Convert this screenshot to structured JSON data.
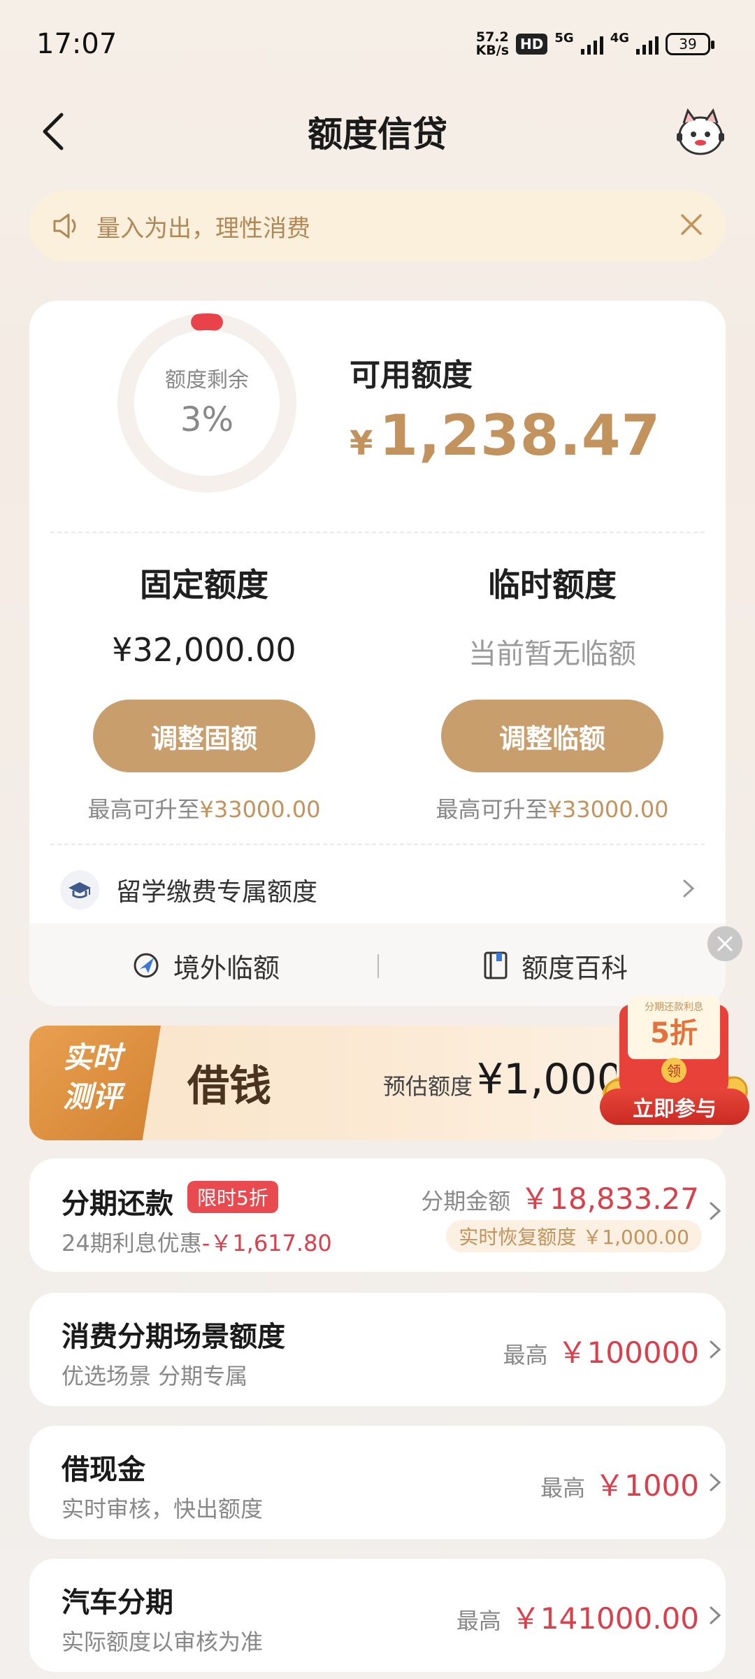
{
  "status": {
    "time": "17:07",
    "speed_top": "57.2",
    "speed_unit": "KB/s",
    "hd": "HD",
    "net1": "5G",
    "net2": "4G",
    "battery": "39"
  },
  "header": {
    "title": "额度信贷"
  },
  "notice": {
    "text": "量入为出，理性消费"
  },
  "credit": {
    "ring_label": "额度剩余",
    "ring_value": "3%",
    "ring_fraction": 0.03,
    "available_label": "可用额度",
    "available_currency": "¥",
    "available_amount": "1,238.47",
    "fixed": {
      "title": "固定额度",
      "value": "¥32,000.00",
      "button": "调整固额",
      "note_prefix": "最高可升至",
      "note_amount": "¥33000.00"
    },
    "temp": {
      "title": "临时额度",
      "value": "当前暂无临额",
      "button": "调整临额",
      "note_prefix": "最高可升至",
      "note_amount": "¥33000.00"
    },
    "study": {
      "label": "留学缴费专属额度"
    },
    "links": {
      "overseas": "境外临额",
      "wiki": "额度百科"
    }
  },
  "banner": {
    "badge_line1": "实时",
    "badge_line2": "测评",
    "title": "借钱",
    "est_label": "预估额度",
    "est_amount": "¥1,000",
    "promo_top": "分期还款利息",
    "promo_discount": "5折",
    "promo_get": "领",
    "promo_button": "立即参与"
  },
  "installment": {
    "title": "分期还款",
    "tag": "限时5折",
    "sub_prefix": "24期利息优惠",
    "sub_amount": "-￥1,617.80",
    "amount_label": "分期金额",
    "amount": "￥18,833.27",
    "restore": "实时恢复额度 ￥1,000.00"
  },
  "items": [
    {
      "title": "消费分期场景额度",
      "sub": "优选场景 分期专属",
      "pre": "最高",
      "amount": "￥100000"
    },
    {
      "title": "借现金",
      "sub": "实时审核，快出额度",
      "pre": "最高",
      "amount": "￥1000"
    },
    {
      "title": "汽车分期",
      "sub": "实际额度以审核为准",
      "pre": "最高",
      "amount": "￥141000.00"
    }
  ],
  "colors": {
    "gold": "#c3935e",
    "button": "#c89e6c",
    "red": "#d9404b",
    "ring_red": "#e8434b"
  }
}
